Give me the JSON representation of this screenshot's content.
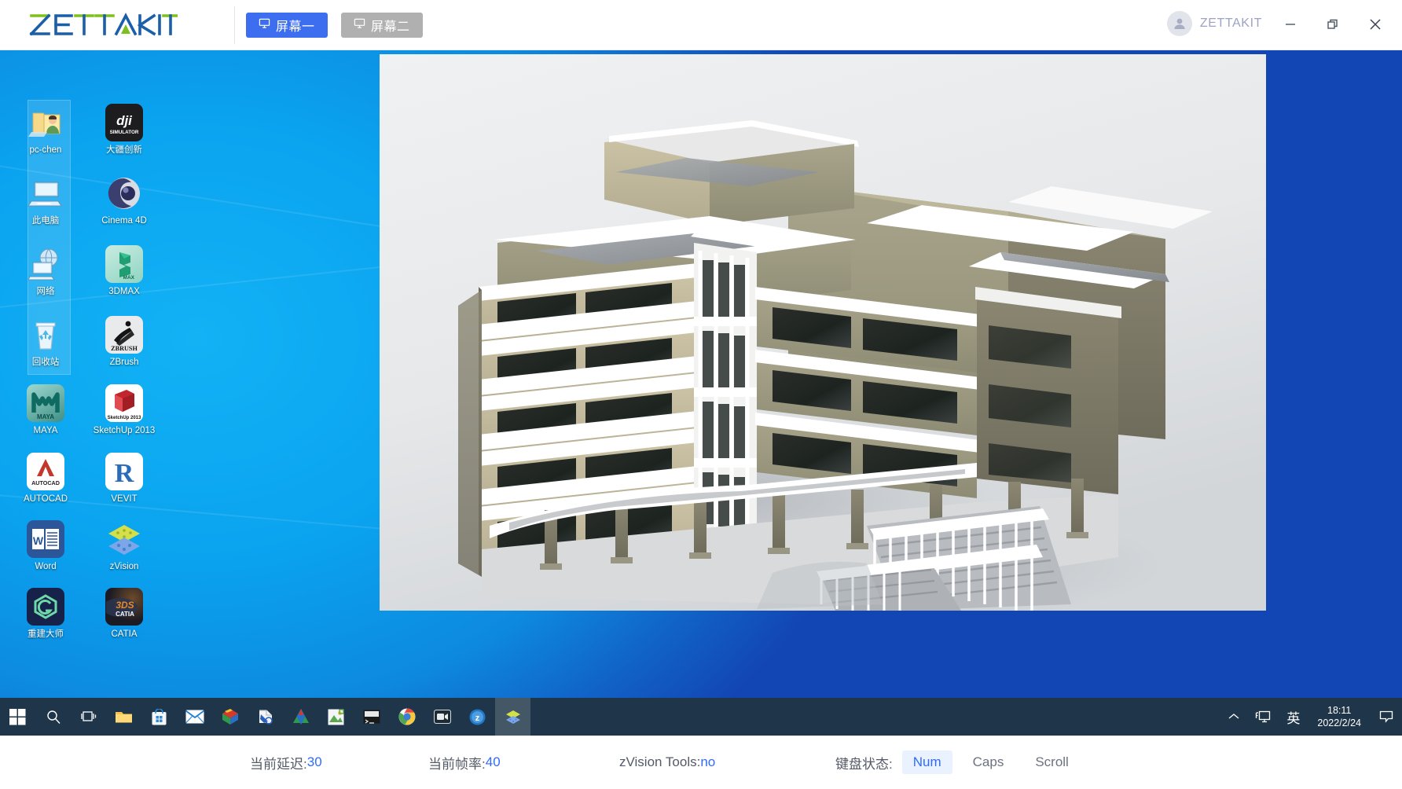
{
  "titlebar": {
    "brand": "ZETTAKIT",
    "user": "ZETTAKIT",
    "tabs": [
      {
        "label": "屏幕一",
        "icon": "monitor-icon",
        "active": true
      },
      {
        "label": "屏幕二",
        "icon": "monitor-icon",
        "active": false
      }
    ],
    "window_controls": [
      {
        "name": "minimize-button",
        "glyph": "—"
      },
      {
        "name": "restore-button",
        "glyph": "❐"
      },
      {
        "name": "close-button",
        "glyph": "✕"
      }
    ],
    "accent": "#3d6ef0",
    "inactive_tab": "#b0b0b0"
  },
  "desktop": {
    "icons_left": [
      {
        "label": "pc-chen",
        "icon": "user-folder-icon"
      },
      {
        "label": "此电脑",
        "icon": "this-pc-icon"
      },
      {
        "label": "网络",
        "icon": "network-icon"
      },
      {
        "label": "回收站",
        "icon": "recycle-bin-icon"
      },
      {
        "label": "MAYA",
        "icon": "maya-icon"
      },
      {
        "label": "AUTOCAD",
        "icon": "autocad-icon"
      },
      {
        "label": "Word",
        "icon": "word-icon"
      },
      {
        "label": "重建大师",
        "icon": "chongjian-dashi-icon"
      }
    ],
    "icons_right": [
      {
        "label": "大疆创新",
        "icon": "dji-simulator-icon"
      },
      {
        "label": "Cinema 4D",
        "icon": "cinema4d-icon"
      },
      {
        "label": "3DMAX",
        "icon": "3dsmax-icon"
      },
      {
        "label": "ZBrush",
        "icon": "zbrush-icon"
      },
      {
        "label": "SketchUp 2013",
        "icon": "sketchup-icon"
      },
      {
        "label": "VEVIT",
        "icon": "revit-icon"
      },
      {
        "label": "zVision",
        "icon": "zvision-icon"
      },
      {
        "label": "CATIA",
        "icon": "catia-icon"
      }
    ]
  },
  "viewer": {
    "content": "3D architectural building render with staircase",
    "background": "#e8eaec"
  },
  "taskbar": {
    "items": [
      {
        "name": "start-button",
        "icon": "windows-logo-icon"
      },
      {
        "name": "search-button",
        "icon": "search-icon"
      },
      {
        "name": "task-view-button",
        "icon": "task-view-icon"
      },
      {
        "name": "file-explorer-button",
        "icon": "folder-icon"
      },
      {
        "name": "microsoft-store-button",
        "icon": "store-icon"
      },
      {
        "name": "mail-button",
        "icon": "mail-icon"
      },
      {
        "name": "sketchup-button",
        "icon": "sketchup-icon"
      },
      {
        "name": "bluebeam-button",
        "icon": "bluebeam-icon"
      },
      {
        "name": "autocad-button",
        "icon": "autocad-icon"
      },
      {
        "name": "photo-button",
        "icon": "photo-icon"
      },
      {
        "name": "terminal-button",
        "icon": "terminal-icon"
      },
      {
        "name": "chrome-button",
        "icon": "chrome-icon"
      },
      {
        "name": "meeting-button",
        "icon": "camera-icon"
      },
      {
        "name": "zoom-button",
        "icon": "z-icon"
      },
      {
        "name": "zvision-button",
        "icon": "zvision-icon",
        "active": true
      }
    ],
    "tray": {
      "chevron": "︿",
      "ime_icon": "ime-monitor-icon",
      "ime_label": "英",
      "time": "18:11",
      "date": "2022/2/24",
      "notification_icon": "notification-icon"
    }
  },
  "statusbar": {
    "latency_label": "当前延迟:",
    "latency_value": "30",
    "fps_label": "当前帧率:",
    "fps_value": "40",
    "tools_label": "zVision Tools:",
    "tools_value": "no",
    "keyboard_label": "键盘状态:",
    "keys": [
      {
        "label": "Num",
        "on": true
      },
      {
        "label": "Caps",
        "on": false
      },
      {
        "label": "Scroll",
        "on": false
      }
    ],
    "value_color": "#2f6bff"
  }
}
